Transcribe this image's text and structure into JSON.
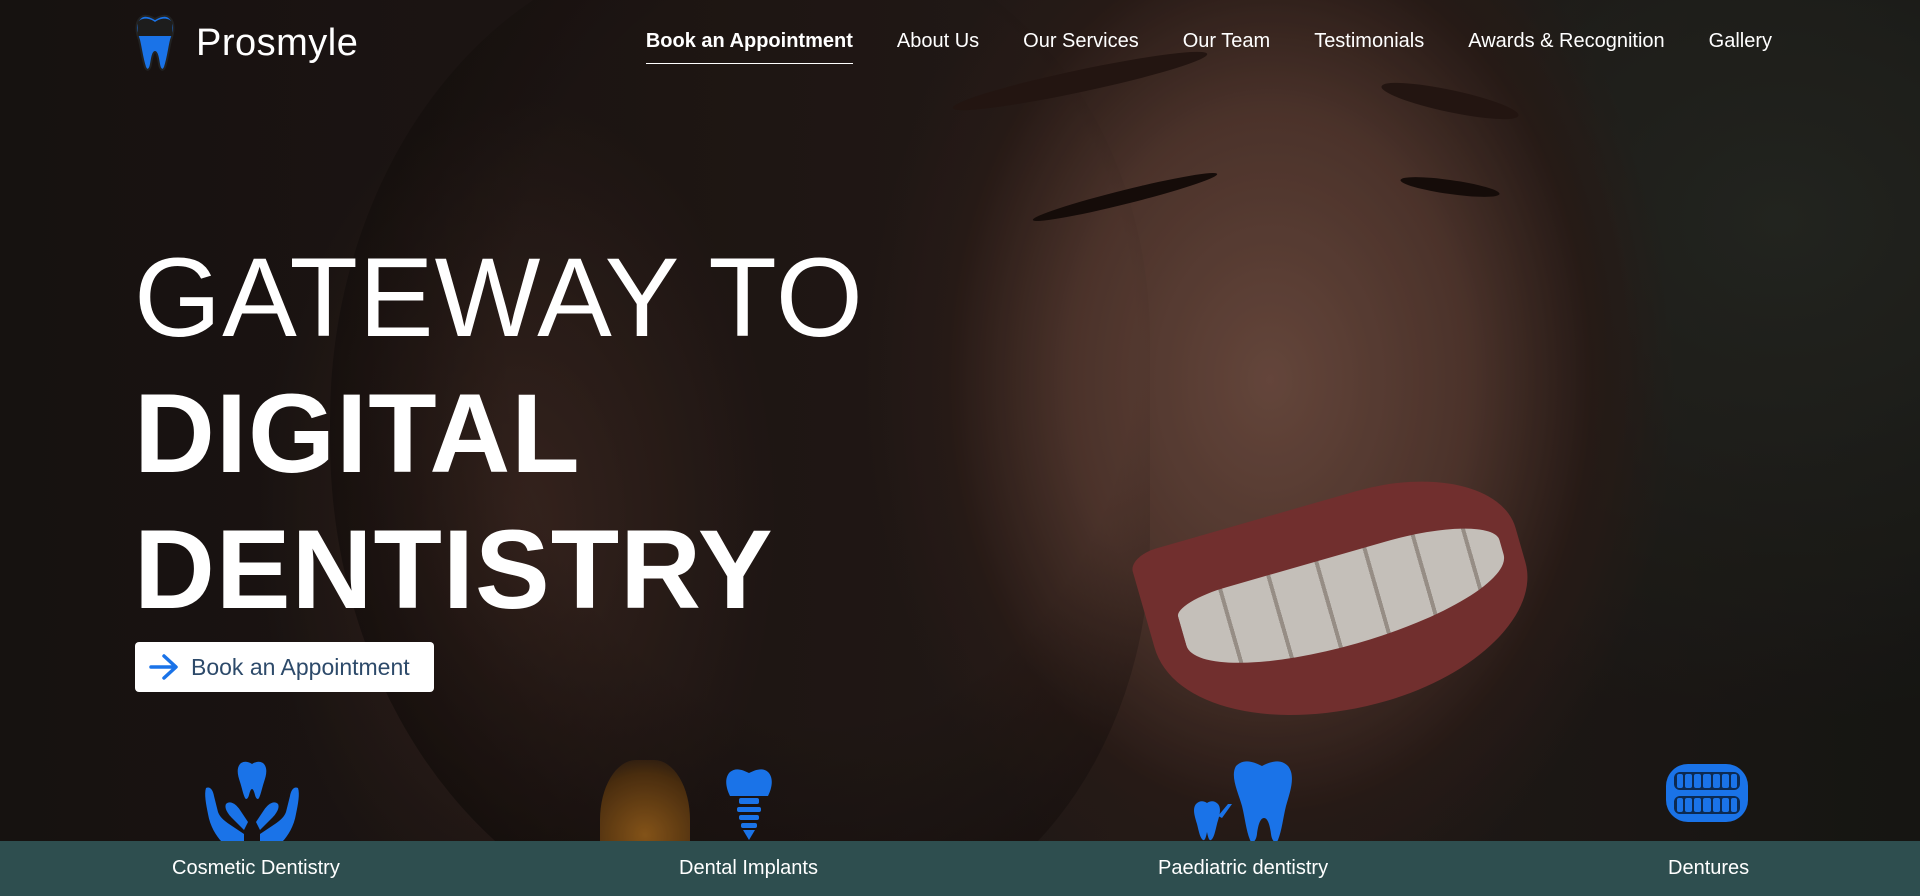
{
  "brand": {
    "name": "Prosmyle",
    "logo_icon": "tooth-icon",
    "accent_color": "#1a73e8"
  },
  "nav": {
    "items": [
      {
        "label": "Book an Appointment",
        "active": true
      },
      {
        "label": "About Us",
        "active": false
      },
      {
        "label": "Our Services",
        "active": false
      },
      {
        "label": "Our Team",
        "active": false
      },
      {
        "label": "Testimonials",
        "active": false
      },
      {
        "label": "Awards & Recognition",
        "active": false
      },
      {
        "label": "Gallery",
        "active": false
      }
    ]
  },
  "hero": {
    "line1": "GATEWAY TO",
    "line2": "DIGITAL",
    "line3": "DENTISTRY",
    "cta_label": "Book an Appointment",
    "cta_icon": "arrow-right-icon"
  },
  "services": {
    "bar_color": "#2e4e4f",
    "items": [
      {
        "label": "Cosmetic Dentistry",
        "icon": "hands-tooth-icon"
      },
      {
        "label": "Dental Implants",
        "icon": "implant-icon"
      },
      {
        "label": "Paediatric dentistry",
        "icon": "child-tooth-icon"
      },
      {
        "label": "Dentures",
        "icon": "dentures-icon"
      }
    ]
  }
}
